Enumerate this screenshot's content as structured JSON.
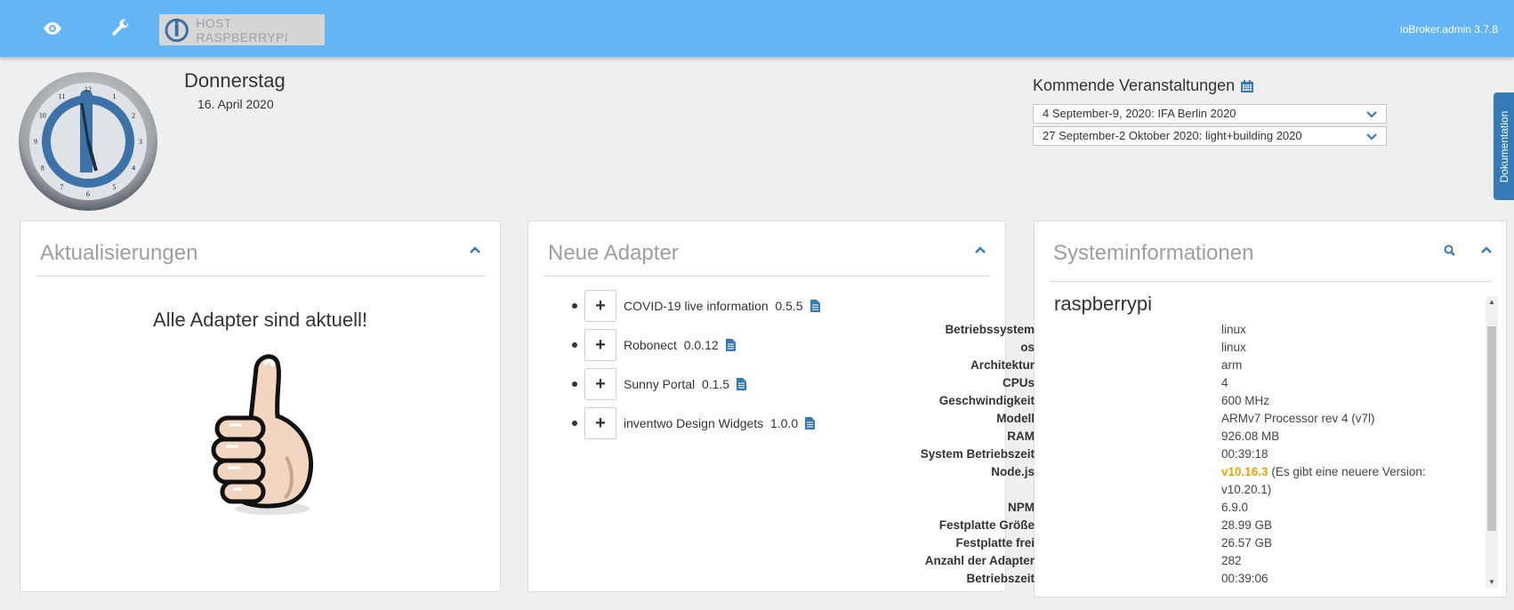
{
  "header": {
    "host_label": "HOST RASPBERRYPI",
    "version": "ioBroker.admin 3.7.8",
    "icons": [
      "eye-icon",
      "wrench-icon",
      "iobroker-logo-icon"
    ],
    "bar_color": "#64b5f6"
  },
  "clock": {
    "numerals": [
      "12",
      "1",
      "2",
      "3",
      "4",
      "5",
      "6",
      "7",
      "8",
      "9",
      "10",
      "11"
    ]
  },
  "date_display": {
    "weekday": "Donnerstag",
    "date": "16. April 2020"
  },
  "events": {
    "title": "Kommende Veranstaltungen",
    "items": [
      "4 September-9, 2020: IFA Berlin 2020",
      "27 September-2 Oktober 2020: light+building 2020"
    ]
  },
  "doc_tab": {
    "label": "Dokumentation"
  },
  "updates_card": {
    "title": "Aktualisierungen",
    "message": "Alle Adapter sind aktuell!"
  },
  "new_adapters_card": {
    "title": "Neue Adapter",
    "plus_label": "+",
    "items": [
      {
        "name": "COVID-19 live information",
        "version": "0.5.5"
      },
      {
        "name": "Robonect",
        "version": "0.0.12"
      },
      {
        "name": "Sunny Portal",
        "version": "0.1.5"
      },
      {
        "name": "inventwo Design Widgets",
        "version": "1.0.0"
      }
    ]
  },
  "system_card": {
    "title": "Systeminformationen",
    "host": "raspberrypi",
    "rows": [
      {
        "key": "Betriebssystem",
        "value": "linux"
      },
      {
        "key": "os",
        "value": "linux"
      },
      {
        "key": "Architektur",
        "value": "arm"
      },
      {
        "key": "CPUs",
        "value": "4"
      },
      {
        "key": "Geschwindigkeit",
        "value": "600 MHz"
      },
      {
        "key": "Modell",
        "value": "ARMv7 Processor rev 4 (v7l)"
      },
      {
        "key": "RAM",
        "value": "926.08 MB"
      },
      {
        "key": "System Betriebszeit",
        "value": "00:39:18"
      },
      {
        "key": "Node.js",
        "value": "v10.16.3",
        "note": "(Es gibt eine neuere Version:",
        "note2": "v10.20.1)"
      },
      {
        "key": "NPM",
        "value": "6.9.0"
      },
      {
        "key": "Festplatte Größe",
        "value": "28.99 GB"
      },
      {
        "key": "Festplatte frei",
        "value": "26.57 GB"
      },
      {
        "key": "Anzahl der Adapter",
        "value": "282"
      },
      {
        "key": "Betriebszeit",
        "value": "00:39:06"
      }
    ],
    "highlight_color": "#f0a000"
  }
}
